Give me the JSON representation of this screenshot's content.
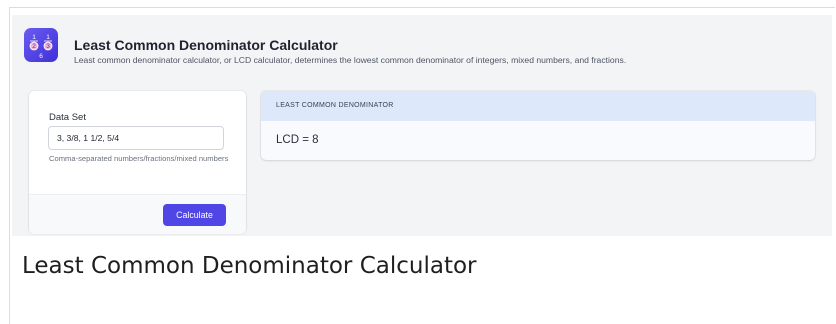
{
  "header": {
    "logo": {
      "icon": "fraction-denominator-logo-icon",
      "digits": [
        "1",
        "1",
        "2",
        "3",
        "6"
      ]
    },
    "title": "Least Common Denominator Calculator",
    "subtitle": "Least common denominator calculator, or LCD calculator, determines the lowest common denominator of integers, mixed numbers, and fractions."
  },
  "input_card": {
    "label": "Data Set",
    "value": "3, 3/8, 1 1/2, 5/4",
    "hint": "Comma-separated numbers/fractions/mixed numbers",
    "button_label": "Calculate"
  },
  "result_card": {
    "header": "LEAST COMMON DENOMINATOR",
    "value": "LCD = 8"
  },
  "page_heading": "Least Common Denominator Calculator",
  "colors": {
    "accent": "#4f46e5",
    "result_header_bg": "#dde8fb",
    "app_bg": "#f3f4f6"
  }
}
